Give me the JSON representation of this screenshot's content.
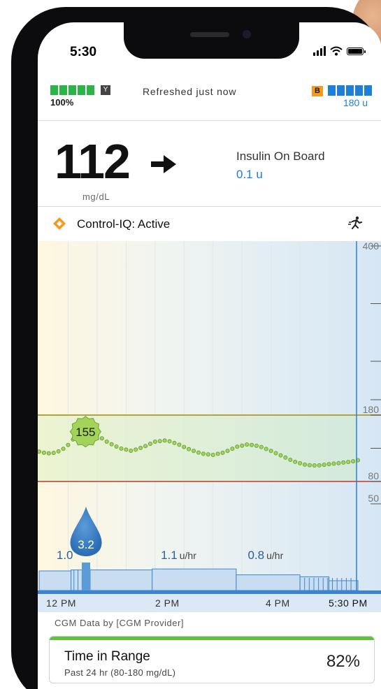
{
  "status_bar": {
    "time": "5:30"
  },
  "header": {
    "phone_battery": "100%",
    "refreshed": "Refreshed just now",
    "pump_badge": "B",
    "pump_insulin": "180 u"
  },
  "glucose": {
    "value": "112",
    "unit": "mg/dL",
    "trend_icon": "arrow-right-icon",
    "iob_label": "Insulin On Board",
    "iob_value": "0.1 u"
  },
  "control_iq": {
    "label": "Control-IQ: Active",
    "activity_icon": "exercise-icon"
  },
  "chart_data": {
    "type": "line",
    "title": "",
    "x_ticks": [
      "12 PM",
      "2 PM",
      "4 PM",
      "5:30 PM"
    ],
    "y_ticks": [
      "400",
      "180",
      "80",
      "50"
    ],
    "target_range": [
      80,
      180
    ],
    "glucose_callout": "155",
    "series": [
      {
        "name": "",
        "x": [
          0.0,
          0.1,
          0.2,
          0.3,
          0.4,
          0.5,
          0.6,
          0.7,
          0.8,
          0.9,
          1.0,
          1.2,
          1.4,
          1.6,
          1.8,
          2.0,
          2.2,
          2.4,
          2.6,
          2.8,
          3.0,
          3.2,
          3.4,
          3.6,
          3.8,
          4.0,
          4.2,
          4.4,
          4.6,
          4.8,
          5.0,
          5.2,
          5.4,
          5.5
        ],
        "values": [
          125,
          123,
          122,
          124,
          128,
          135,
          145,
          152,
          155,
          154,
          150,
          138,
          130,
          126,
          132,
          140,
          142,
          136,
          128,
          122,
          120,
          124,
          132,
          136,
          133,
          126,
          118,
          110,
          105,
          104,
          106,
          108,
          110,
          112
        ]
      }
    ],
    "bolus": {
      "value": "3.2",
      "time_hours": 0.7
    },
    "basal_labels": [
      {
        "value": "1.0",
        "unit": ""
      },
      {
        "value": "1.1",
        "unit": "u/hr"
      },
      {
        "value": "0.8",
        "unit": "u/hr"
      }
    ]
  },
  "cgm_source": "CGM Data by [CGM Provider]",
  "time_in_range": {
    "title": "Time in Range",
    "subtitle": "Past 24 hr (80-180 mg/dL)",
    "percent": "82%"
  },
  "colors": {
    "accent_blue": "#1e7fd4",
    "green": "#2db34a",
    "orange": "#f59a1c",
    "range_line": "#b5a43a",
    "low_line": "#c0392b"
  }
}
